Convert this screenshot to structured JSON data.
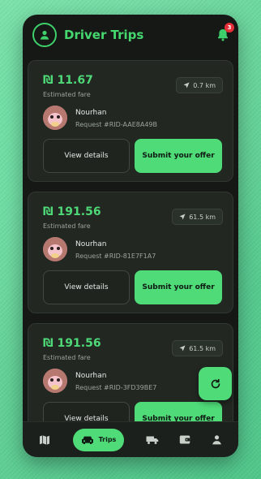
{
  "header": {
    "title": "Driver Trips",
    "notification_count": "3"
  },
  "trips": [
    {
      "fare": "₪ 11.67",
      "fare_label": "Estimated fare",
      "distance": "0.7 km",
      "rider_name": "Nourhan",
      "request_id": "Request #RID-AAE8A49B",
      "details_label": "View details",
      "offer_label": "Submit your offer"
    },
    {
      "fare": "₪ 191.56",
      "fare_label": "Estimated fare",
      "distance": "61.5 km",
      "rider_name": "Nourhan",
      "request_id": "Request #RID-81E7F1A7",
      "details_label": "View details",
      "offer_label": "Submit your offer"
    },
    {
      "fare": "₪ 191.56",
      "fare_label": "Estimated fare",
      "distance": "61.5 km",
      "rider_name": "Nourhan",
      "request_id": "Request #RID-3FD39BE7",
      "details_label": "View details",
      "offer_label": "Submit your offer"
    }
  ],
  "bottom_nav": {
    "items": [
      {
        "icon": "map-icon"
      },
      {
        "icon": "car-icon",
        "label": "Trips",
        "active": true
      },
      {
        "icon": "truck-icon"
      },
      {
        "icon": "wallet-icon"
      },
      {
        "icon": "person-icon"
      }
    ]
  },
  "colors": {
    "accent": "#4fdb78",
    "card_bg": "#222722",
    "app_bg": "#151815",
    "badge": "#e5303a"
  }
}
